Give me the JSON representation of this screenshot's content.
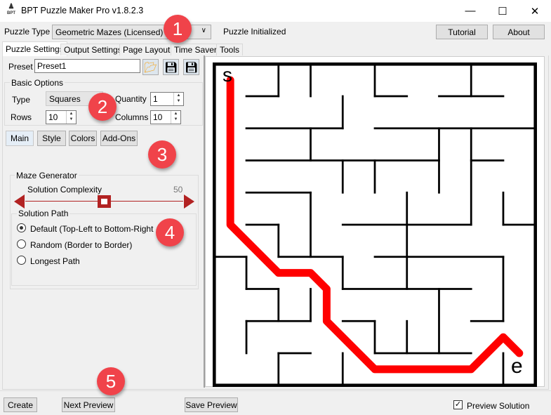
{
  "window": {
    "title": "BPT Puzzle Maker Pro v1.8.2.3",
    "icon_text": "BPT",
    "controls": [
      "minimize-icon",
      "maximize-icon",
      "close-icon"
    ]
  },
  "toolbar": {
    "puzzle_type_label": "Puzzle Type",
    "puzzle_type_value": "Geometric Mazes (Licensed)",
    "status": "Puzzle Initialized",
    "tutorial": "Tutorial",
    "about": "About"
  },
  "tabs": [
    {
      "label": "Puzzle Settings",
      "active": true
    },
    {
      "label": "Output Settings"
    },
    {
      "label": "Page Layout"
    },
    {
      "label": "Time Saver"
    },
    {
      "label": "Tools"
    }
  ],
  "preset": {
    "label": "Preset",
    "value": "Preset1",
    "icons": [
      "folder-open-icon",
      "save-icon",
      "save-as-icon"
    ]
  },
  "basic_options": {
    "title": "Basic Options",
    "type_label": "Type",
    "type_value": "Squares",
    "quantity_label": "Quantity",
    "quantity_value": "1",
    "rows_label": "Rows",
    "rows_value": "10",
    "columns_label": "Columns",
    "columns_value": "10"
  },
  "subtabs": [
    {
      "label": "Main",
      "active": true
    },
    {
      "label": "Style"
    },
    {
      "label": "Colors"
    },
    {
      "label": "Add-Ons"
    }
  ],
  "maze_generator": {
    "title": "Maze Generator",
    "complexity_label": "Solution Complexity",
    "complexity_value": "50",
    "slider_fraction": 0.5,
    "accent": "#b22222"
  },
  "solution_path": {
    "title": "Solution Path",
    "options": [
      {
        "label": "Default (Top-Left to Bottom-Right",
        "selected": true
      },
      {
        "label": "Random (Border to Border)"
      },
      {
        "label": "Longest Path"
      }
    ]
  },
  "preview": {
    "start_label": "s",
    "end_label": "e",
    "path_color": "#ff0000",
    "grid": "10x10"
  },
  "bottom": {
    "create": "Create",
    "next_preview": "Next Preview",
    "save_preview": "Save Preview",
    "preview_solution": "Preview Solution",
    "preview_solution_checked": true
  },
  "badges": [
    "1",
    "2",
    "3",
    "4",
    "5"
  ],
  "badge_color": "#f0434a"
}
